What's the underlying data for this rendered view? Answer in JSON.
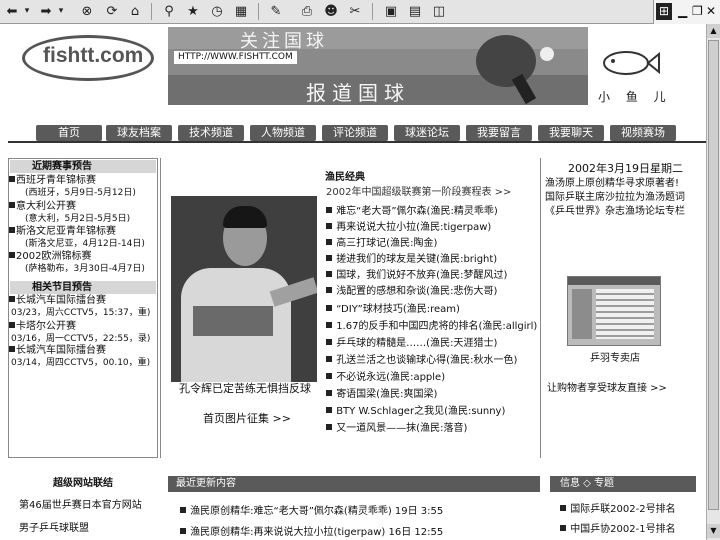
{
  "toolbar": {
    "icons": [
      "back-icon",
      "dropdown-icon",
      "forward-icon",
      "dropdown-icon",
      "stop-icon",
      "refresh-icon",
      "home-icon",
      "search-icon",
      "favorites-icon",
      "history-icon",
      "channels-icon",
      "edit-icon",
      "print-icon",
      "messenger-icon",
      "discuss-icon",
      "news-icon",
      "calc-icon"
    ],
    "window_controls": [
      "minimize-icon",
      "restore-icon",
      "close-icon"
    ]
  },
  "header": {
    "logo_text": "fishtt.com",
    "banner_top": "关注国球",
    "banner_url": "HTTP://WWW.FISHTT.COM",
    "banner_bottom": "报道国球",
    "brand_name": "小 鱼 儿"
  },
  "nav": {
    "tabs": [
      "首页",
      "球友档案",
      "技术频道",
      "人物频道",
      "评论频道",
      "球迷论坛",
      "我要留言",
      "我要聊天",
      "视频赛场"
    ]
  },
  "left": {
    "recent_title": "近期赛事预告",
    "recent_items": [
      {
        "title": "西班牙青年锦标赛",
        "sub": "(西班牙，5月9日-5月12日)"
      },
      {
        "title": "意大利公开赛",
        "sub": "(意大利，5月2日-5月5日)"
      },
      {
        "title": "斯洛文尼亚青年锦标赛",
        "sub": "(斯洛文尼亚，4月12日-14日)"
      },
      {
        "title": "2002欧洲锦标赛",
        "sub": "(萨格勒布，3月30日-4月7日)"
      }
    ],
    "program_title": "相关节目预告",
    "program_items": [
      {
        "title": "长城汽车国际擂台赛",
        "sub": "03/23，周六CCTV5，15:37，重)"
      },
      {
        "title": "卡塔尔公开赛",
        "sub": "03/16，周一CCTV5，22:55，录)"
      },
      {
        "title": "长城汽车国际擂台赛",
        "sub": "03/14，周四CCTV5，00.10，重)"
      }
    ]
  },
  "middle": {
    "photo_caption": "孔令辉已定苦练无惧挡反球",
    "photo_link": "首页图片征集 >>",
    "classics_title": "渔民经典",
    "classics": [
      "2002年中国超级联赛第一阶段赛程表 >>",
      "难忘“老大哥”佩尔森(渔民:精灵乖乖)",
      "再来说说大拉小拉(渔民:tigerpaw)",
      "高三打球记(渔民:陶金)",
      "搓进我们的球友是关键(渔民:bright)",
      "国球，我们说好不放弃(渔民:梦醒风过)",
      "浅配置的感想和杂谈(渔民:悲伤大哥)",
      "“DIY”球材技巧(渔民:ream)",
      "1.67的反手和中国四虎将的排名(渔民:allgirl)",
      "乒乓球的精髓是……(渔民:天涯猎士)",
      "孔送兰活之也谈输球心得(渔民:秋水一色)",
      "不必说永远(渔民:apple)",
      "寄语国梁(渔民:爽国梁)",
      "BTY W.Schlager之我见(渔民:sunny)",
      "又一道风景——抹(渔民:落音)"
    ]
  },
  "right": {
    "date": "2002年3月19日星期二",
    "news": [
      "渔汤原上原创精华寻求原著者!",
      "国际乒联主席沙拉拉为渔汤题词",
      "《乒乓世界》杂志渔场论坛专栏"
    ],
    "shop_caption": "乒羽专卖店",
    "shop_link": "让购物者享受球友直接 >>"
  },
  "bottom": {
    "links_title": "超级网站联结",
    "links": [
      "第46届世乒赛日本官方网站",
      "男子乒乓球联盟"
    ],
    "updates_title": "最近更新内容",
    "updates": [
      "渔民原创精华:难忘“老大哥”佩尔森(精灵乖乖) 19日 3:55",
      "渔民原创精华:再来说说大拉小拉(tigerpaw) 16日 12:55"
    ],
    "info_title": "信息 ◇ 专题",
    "info": [
      "国际乒联2002-2号排名",
      "中国乒协2002-1号排名"
    ]
  }
}
